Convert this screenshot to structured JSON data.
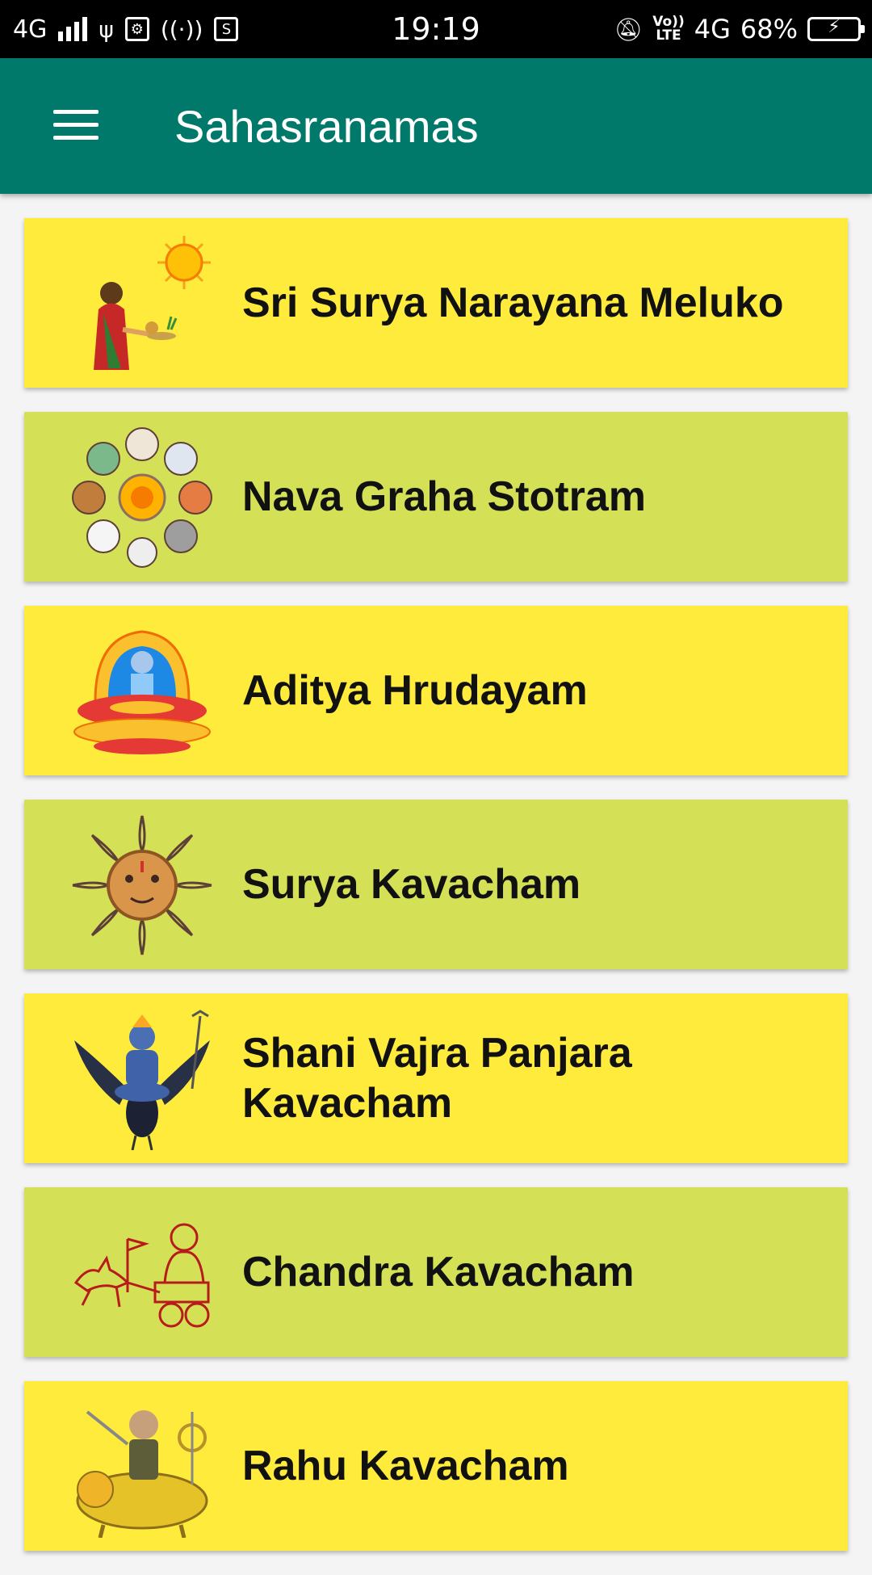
{
  "status_bar": {
    "network": "4G",
    "time": "19:19",
    "volte_top": "Vo))",
    "volte_bottom": "LTE",
    "network_right": "4G",
    "battery": "68%"
  },
  "app_bar": {
    "title": "Sahasranamas",
    "color": "#00796b"
  },
  "items": [
    {
      "label": "Sri Surya Narayana Meluko",
      "icon": "surya-offering-icon",
      "color": "#ffeb3b"
    },
    {
      "label": "Nava Graha Stotram",
      "icon": "navagraha-icon",
      "color": "#d4e157"
    },
    {
      "label": "Aditya Hrudayam",
      "icon": "deity-throne-icon",
      "color": "#ffeb3b"
    },
    {
      "label": "Surya Kavacham",
      "icon": "sun-face-icon",
      "color": "#d4e157"
    },
    {
      "label": "Shani Vajra Panjara Kavacham",
      "icon": "shani-crow-icon",
      "color": "#ffeb3b"
    },
    {
      "label": "Chandra Kavacham",
      "icon": "chandra-chariot-icon",
      "color": "#d4e157"
    },
    {
      "label": "Rahu Kavacham",
      "icon": "rahu-lion-icon",
      "color": "#ffeb3b"
    }
  ]
}
